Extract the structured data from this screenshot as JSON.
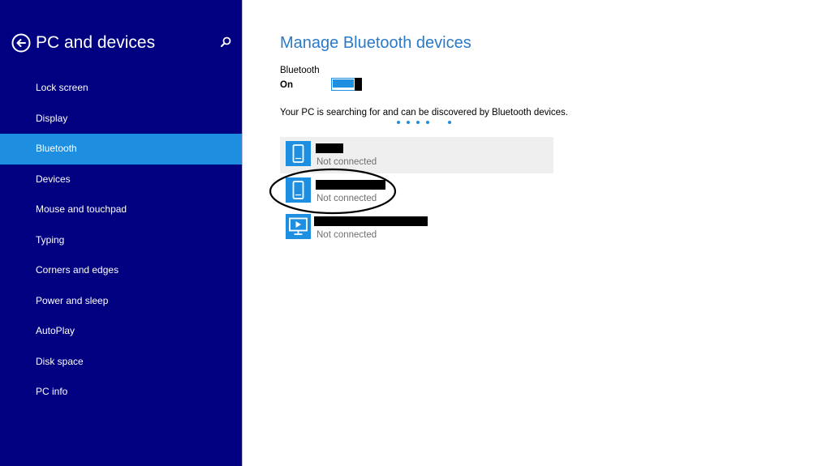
{
  "sidebar": {
    "title": "PC and devices",
    "back_icon": "back-arrow-icon",
    "search_icon": "search-icon",
    "items": [
      {
        "label": "Lock screen",
        "selected": false
      },
      {
        "label": "Display",
        "selected": false
      },
      {
        "label": "Bluetooth",
        "selected": true
      },
      {
        "label": "Devices",
        "selected": false
      },
      {
        "label": "Mouse and touchpad",
        "selected": false
      },
      {
        "label": "Typing",
        "selected": false
      },
      {
        "label": "Corners and edges",
        "selected": false
      },
      {
        "label": "Power and sleep",
        "selected": false
      },
      {
        "label": "AutoPlay",
        "selected": false
      },
      {
        "label": "Disk space",
        "selected": false
      },
      {
        "label": "PC info",
        "selected": false
      }
    ]
  },
  "main": {
    "title": "Manage Bluetooth devices",
    "bluetooth_label": "Bluetooth",
    "bluetooth_state": "On",
    "bluetooth_on": true,
    "searching_message": "Your PC is searching for and can be discovered by Bluetooth devices.",
    "devices": [
      {
        "name": "",
        "status": "Not connected",
        "icon": "phone-icon",
        "highlighted": true,
        "circled": false
      },
      {
        "name": "",
        "status": "Not connected",
        "icon": "phone-icon",
        "highlighted": false,
        "circled": true
      },
      {
        "name": "",
        "status": "Not connected",
        "icon": "display-icon",
        "highlighted": false,
        "circled": false
      }
    ]
  },
  "colors": {
    "sidebar_bg": "#000080",
    "accent": "#1e8fe0",
    "title_blue": "#2a7ac7",
    "status_gray": "#707070",
    "hover_bg": "#efefef"
  }
}
